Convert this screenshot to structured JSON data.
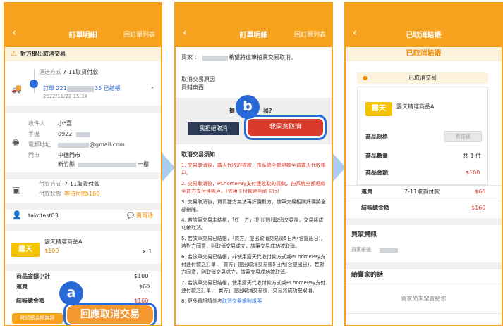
{
  "colors": {
    "brand": "#f7a21c",
    "accent_blue": "#2a6ad8",
    "danger_red": "#d93a2b",
    "dark_button": "#2b3a55"
  },
  "screen1": {
    "header": {
      "back_icon": "‹",
      "title": "訂單明細",
      "right_link": "回訂單列表"
    },
    "notice": "對方提出取消交易",
    "delivery": {
      "label": "運送方式",
      "value": "7-11取貨付款",
      "order_prefix": "訂單 2211",
      "order_suffix": "35 已結帳",
      "date": "2022/11/22 15:34"
    },
    "recipient": {
      "name_label": "收件人",
      "name": "小*嘉",
      "phone_label": "手機",
      "phone": "0922",
      "email_label": "電郵地址",
      "email": "@gmail.com",
      "store_label": "門市",
      "store": "中德門市",
      "address": "新竹縣",
      "address_tail": "一樓"
    },
    "payment": {
      "method_label": "付款方式",
      "method": "7-11取貨付款",
      "status_label": "付款狀態",
      "status": "等待付款",
      "amount": "$160"
    },
    "seller": {
      "name": "takotest03",
      "chat": "賣買通"
    },
    "product": {
      "logo": "露天",
      "name": "露天精選商品A",
      "price": "$100",
      "qty": "× 1"
    },
    "totals": {
      "subtotal_label": "商品金額小計",
      "subtotal": "$100",
      "shipping_label": "運費",
      "shipping": "$60",
      "total_label": "結帳總金額",
      "total": "$160"
    },
    "confirm_btn": "確認總金額無誤",
    "respond_btn": "回應取消交易"
  },
  "screen2": {
    "header": {
      "back_icon": "‹",
      "title": "訂單明細",
      "right_link": "回訂單列表"
    },
    "buyer_prefix": "買家 t",
    "buyer_suffix": "希望將這筆拍賣交易取消。",
    "reason_label": "取消交易原因",
    "reason": "買錯東西",
    "question_a": "提",
    "question_b": "易?",
    "reject_btn": "我拒絕取消",
    "accept_btn": "我同意取消",
    "notes_title": "取消交易須知",
    "notes": [
      "1. 交易取消後，露天代收的貨款，由系統全額退款至買露天代收帳戶。",
      "2. 交易取消後，PChomePay支付連收取的貨款，由系統全額退款至買方支付連帳戶。(信用卡付款退至刷卡行)",
      "3. 交易取消後，買賣雙方無法再評價對方，該筆交易相關評價將全部刪除。",
      "4. 若該筆交易未結帳，「任一方」提出提出取消交易後，交易將成功被取消。",
      "5. 若該筆交易已結帳，「買方」提出取消交易後5日內(含提出日)，若對方同意，則取消交易成立，該筆交易成功被取消。",
      "6. 若該筆交易已結帳，非使用露天代收付款方式或PChomePay支付連付款之訂單，「買方」提出取消交易後5日內(含提出日)，若對方同意，則取消交易成立，該筆交易成功被取消。",
      "7. 若該筆交易已結帳，使用露天代收付款方式或PChomePay支付連付款之訂單，「賣方」提出取消交易後，交易將成功被取消。"
    ],
    "note8_prefix": "8. 更多資訊請參考",
    "note8_link": "取消交易規則說明"
  },
  "screen3": {
    "header": {
      "back_icon": "‹",
      "title": "已取消結帳"
    },
    "banner": "已取消結帳",
    "status": "已取消交易",
    "product": {
      "logo": "露天",
      "name": "露天精選商品A",
      "spec_label": "商品規格",
      "spec_btn": "看詳細",
      "qty_label": "商品數量",
      "qty": "共 1 件",
      "amount_label": "商品金額",
      "amount": "$100"
    },
    "shipping_label": "運費",
    "shipping_method": "7-11取貨付款",
    "shipping": "$60",
    "total_label": "結帳總金額",
    "total": "$160",
    "buyer_section": "買家資訊",
    "buyer_account_label": "買家帳號",
    "note_section": "給賣家的話",
    "note_empty": "買家尚未留言給您"
  },
  "callouts": {
    "a": "a",
    "b": "b"
  }
}
